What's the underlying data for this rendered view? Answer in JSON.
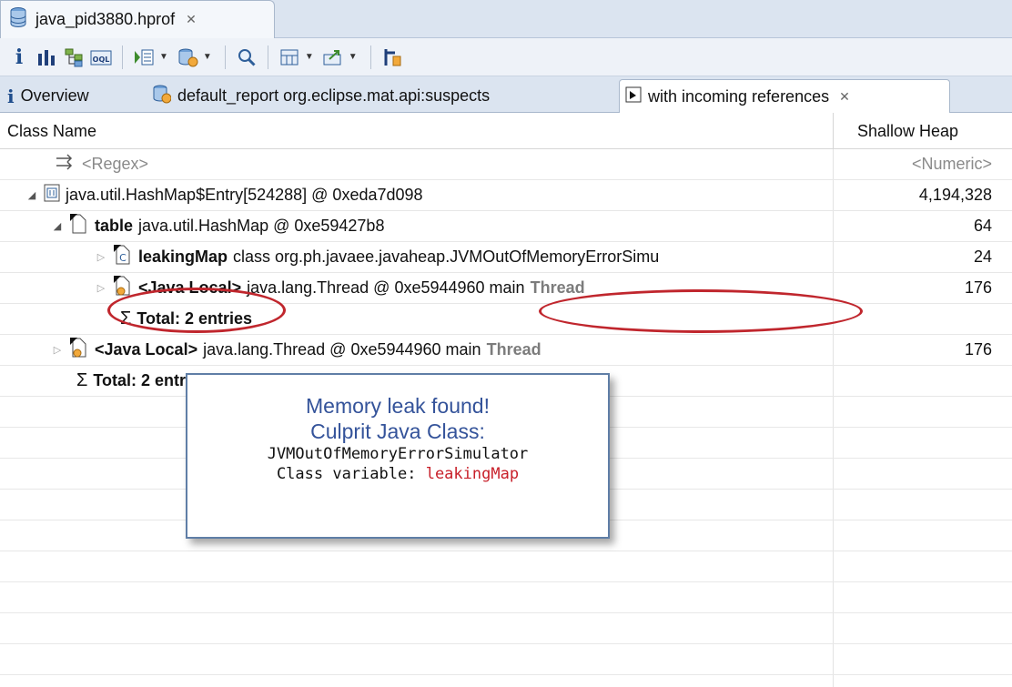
{
  "editor_tab": {
    "title": "java_pid3880.hprof"
  },
  "toolbar": {
    "buttons": [
      "info-icon",
      "histogram-icon",
      "dominator-tree-icon",
      "oql-icon",
      "run-expert-icon",
      "query-browser-icon",
      "search-icon",
      "calculator-icon",
      "export-icon",
      "heap-dump-overview-icon"
    ]
  },
  "result_tabs": {
    "overview": "Overview",
    "report": "default_report  org.eclipse.mat.api:suspects",
    "incoming": "with incoming references"
  },
  "table": {
    "columns": {
      "class_name": "Class Name",
      "shallow_heap": "Shallow Heap"
    },
    "filter": {
      "regex": "<Regex>",
      "numeric": "<Numeric>"
    },
    "rows": [
      {
        "name": "java.util.HashMap$Entry[524288] @ 0xeda7d098",
        "value": "4,194,328"
      },
      {
        "field": "table",
        "name": "java.util.HashMap @ 0xe59427b8",
        "value": "64"
      },
      {
        "field": "leakingMap",
        "name": "class org.ph.javaee.javaheap.JVMOutOfMemoryErrorSimu",
        "value": "24"
      },
      {
        "field": "<Java Local>",
        "name": "java.lang.Thread @ 0xe5944960  main",
        "suffix": "Thread",
        "value": "176"
      },
      {
        "total": "Total: 2 entries"
      },
      {
        "field": "<Java Local>",
        "name": "java.lang.Thread @ 0xe5944960  main",
        "suffix": "Thread",
        "value": "176"
      },
      {
        "total": "Total: 2 entries"
      }
    ],
    "sigma": "Σ"
  },
  "callout": {
    "line1": "Memory leak found!",
    "line2": "Culprit Java Class:",
    "line3": "JVMOutOfMemoryErrorSimulator",
    "line4_label": "Class variable: ",
    "line4_value": "leakingMap"
  },
  "colors": {
    "highlight": "#c0262d",
    "callout_title": "#34539a",
    "callout_border": "#5f7ea6"
  }
}
